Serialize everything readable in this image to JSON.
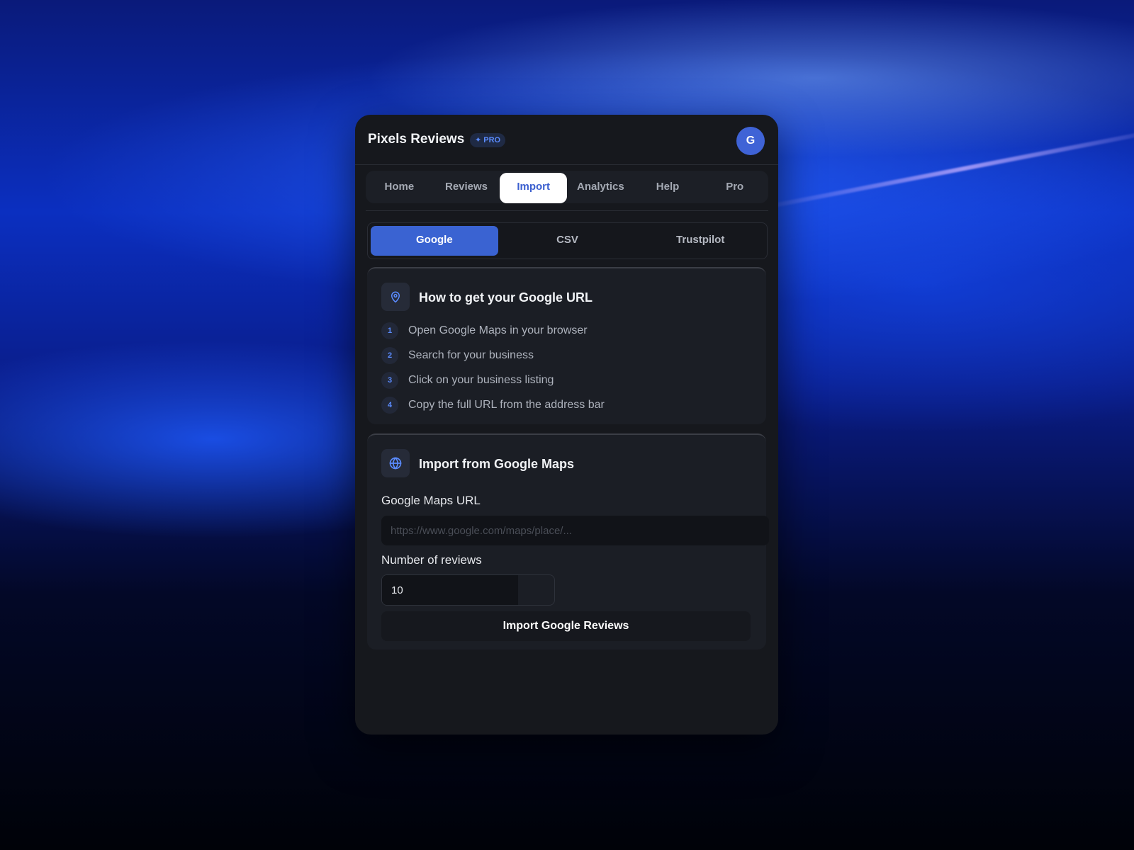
{
  "app": {
    "title": "Pixels Reviews",
    "badge": "PRO",
    "avatar_initial": "G"
  },
  "nav": {
    "items": [
      {
        "label": "Home"
      },
      {
        "label": "Reviews"
      },
      {
        "label": "Import",
        "active": true
      },
      {
        "label": "Analytics"
      },
      {
        "label": "Help"
      },
      {
        "label": "Pro"
      }
    ]
  },
  "source_tabs": {
    "items": [
      {
        "label": "Google",
        "active": true
      },
      {
        "label": "CSV"
      },
      {
        "label": "Trustpilot"
      }
    ]
  },
  "guide": {
    "icon": "map-pin-icon",
    "title": "How to get your Google URL",
    "steps": [
      {
        "num": "1",
        "text": "Open Google Maps in your browser"
      },
      {
        "num": "2",
        "text": "Search for your business"
      },
      {
        "num": "3",
        "text": "Click on your business listing"
      },
      {
        "num": "4",
        "text": "Copy the full URL from the address bar"
      }
    ]
  },
  "import_form": {
    "icon": "globe-icon",
    "title": "Import from Google Maps",
    "url_label": "Google Maps URL",
    "url_placeholder": "https://www.google.com/maps/place/...",
    "url_value": "",
    "count_label": "Number of reviews",
    "count_value": "10",
    "submit_label": "Import Google Reviews"
  },
  "colors": {
    "accent": "#3a63d2",
    "badge_text": "#5b8cff",
    "panel_bg": "#16181d"
  }
}
